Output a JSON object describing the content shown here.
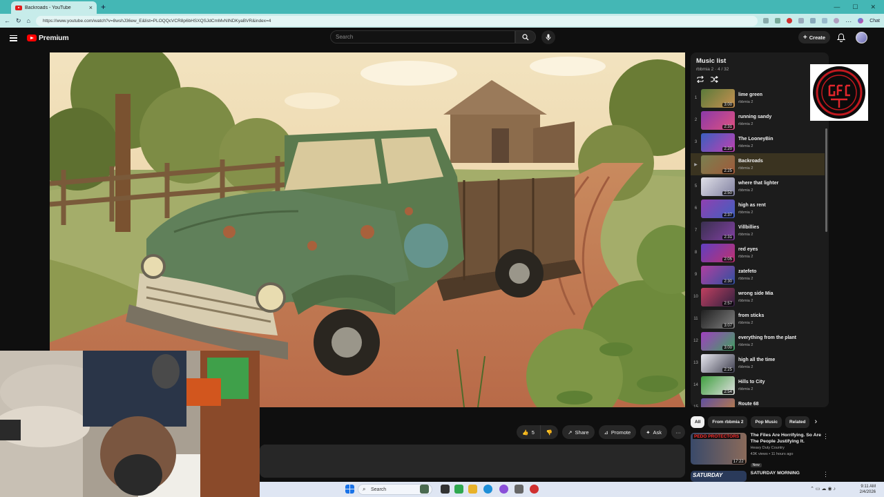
{
  "browser": {
    "tab_title": "Backroads - YouTube",
    "tab_close": "×",
    "new_tab": "+",
    "url": "https://www.youtube.com/watch?v=8wshJ36ew_E&list=PLOQQcVCR8p6bHSXQSJdCmMvNINDKyaBVR&index=4",
    "chat_label": "Chat"
  },
  "header": {
    "logo_text": "Premium",
    "search_placeholder": "Search",
    "create_label": "Create"
  },
  "actions": {
    "like_count": "5",
    "share_label": "Share",
    "promote_label": "Promote",
    "ask_label": "Ask"
  },
  "playlist": {
    "title": "Music list",
    "subtitle": "rbbmia 2 · 4 / 32",
    "items": [
      {
        "num": "1",
        "title": "lime green",
        "channel": "rbbmia 2",
        "duration": "3:00",
        "c1": "#5a7a3a",
        "c2": "#c89050"
      },
      {
        "num": "2",
        "title": "running sandy",
        "channel": "rbbmia 2",
        "duration": "2:31",
        "c1": "#8a3aa8",
        "c2": "#e05080"
      },
      {
        "num": "3",
        "title": "The LooneyBin",
        "channel": "rbbmia 2",
        "duration": "2:20",
        "c1": "#3a60c0",
        "c2": "#c040b0"
      },
      {
        "num": "▶",
        "title": "Backroads",
        "channel": "rbbmia 2",
        "duration": "2:25",
        "c1": "#7a8050",
        "c2": "#a05a3a"
      },
      {
        "num": "5",
        "title": "where that lighter",
        "channel": "rbbmia 2",
        "duration": "2:50",
        "c1": "#e0e0e8",
        "c2": "#8080a0"
      },
      {
        "num": "6",
        "title": "high as rent",
        "channel": "rbbmia 2",
        "duration": "2:37",
        "c1": "#9040b0",
        "c2": "#4060c0"
      },
      {
        "num": "7",
        "title": "Villbillies",
        "channel": "rbbmia 2",
        "duration": "2:31",
        "c1": "#3a3050",
        "c2": "#8040a0"
      },
      {
        "num": "8",
        "title": "red eyes",
        "channel": "rbbmia 2",
        "duration": "2:05",
        "c1": "#6040c0",
        "c2": "#c03070"
      },
      {
        "num": "9",
        "title": "zatefeto",
        "channel": "rbbmia 2",
        "duration": "2:30",
        "c1": "#b040a0",
        "c2": "#3050a0"
      },
      {
        "num": "10",
        "title": "wrong side Mia",
        "channel": "rbbmia 2",
        "duration": "2:57",
        "c1": "#c04060",
        "c2": "#302040"
      },
      {
        "num": "11",
        "title": "from sticks",
        "channel": "rbbmia 2",
        "duration": "3:07",
        "c1": "#202020",
        "c2": "#808080"
      },
      {
        "num": "12",
        "title": "everything from the plant",
        "channel": "rbbmia 2",
        "duration": "3:00",
        "c1": "#a040c0",
        "c2": "#40a060"
      },
      {
        "num": "13",
        "title": "high all the time",
        "channel": "rbbmia 2",
        "duration": "2:25",
        "c1": "#e8e8f0",
        "c2": "#404050"
      },
      {
        "num": "14",
        "title": "Hills to City",
        "channel": "rbbmia 2",
        "duration": "2:54",
        "c1": "#40a040",
        "c2": "#e0e0e0"
      },
      {
        "num": "15",
        "title": "Route 68",
        "channel": "rbbmia 2",
        "duration": "",
        "c1": "#6050a0",
        "c2": "#c08040"
      }
    ]
  },
  "chips": [
    "All",
    "From rbbmia 2",
    "Pop Music",
    "Related"
  ],
  "recommendations": [
    {
      "title": "The Files Are Horrifying. So Are The People Justifying It.",
      "channel": "Heavy Duty Country",
      "meta": "43K views • 11 hours ago",
      "badge": "New",
      "duration": "17:22",
      "thumb_text": "PEDO PROTECTORS"
    },
    {
      "title": "SATURDAY MORNING",
      "thumb_text": "SATURDAY"
    }
  ],
  "taskbar": {
    "search_label": "Search",
    "time": "9:11 AM",
    "date": "2/4/2026"
  },
  "colors": {
    "youtube_red": "#ff0000",
    "browser_teal": "#44b7b5",
    "truck_green": "#5b7a4e"
  }
}
